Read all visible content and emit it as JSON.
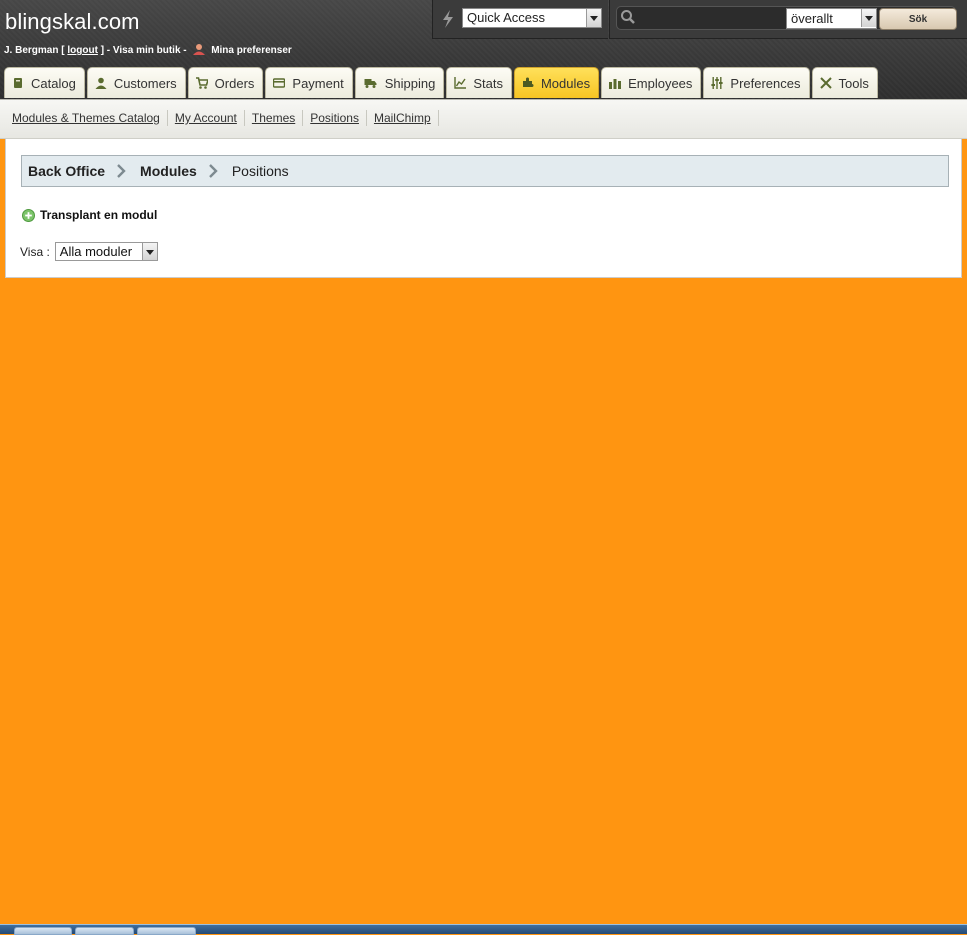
{
  "header": {
    "shop_name": "blingskal.com",
    "user_name": "J. Bergman [",
    "logout_label": "logout",
    "after_logout": "] - Visa min butik -",
    "preferences_label": "Mina preferenser"
  },
  "quick_access": {
    "label": "Quick Access"
  },
  "search": {
    "value": "",
    "scope_value": "överallt",
    "button_label": "Sök"
  },
  "tabs": [
    {
      "label": "Catalog",
      "icon": "book-icon"
    },
    {
      "label": "Customers",
      "icon": "person-icon"
    },
    {
      "label": "Orders",
      "icon": "cart-icon"
    },
    {
      "label": "Payment",
      "icon": "card-icon"
    },
    {
      "label": "Shipping",
      "icon": "truck-icon"
    },
    {
      "label": "Stats",
      "icon": "chart-icon"
    },
    {
      "label": "Modules",
      "icon": "puzzle-icon",
      "active": true
    },
    {
      "label": "Employees",
      "icon": "group-icon"
    },
    {
      "label": "Preferences",
      "icon": "sliders-icon"
    },
    {
      "label": "Tools",
      "icon": "tools-icon"
    }
  ],
  "subnav": [
    {
      "label": "Modules & Themes Catalog"
    },
    {
      "label": "My Account"
    },
    {
      "label": "Themes"
    },
    {
      "label": "Positions"
    },
    {
      "label": "MailChimp"
    }
  ],
  "breadcrumb": {
    "items": [
      "Back Office",
      "Modules",
      "Positions"
    ]
  },
  "actions": {
    "transplant_label": "Transplant en modul"
  },
  "filter": {
    "label": "Visa :",
    "selected": "Alla moduler"
  },
  "colors": {
    "page_background": "#ff9511",
    "header_background": "#3a3a3a",
    "active_tab": "#f7c523",
    "breadcrumb_background": "#e3ebef"
  }
}
